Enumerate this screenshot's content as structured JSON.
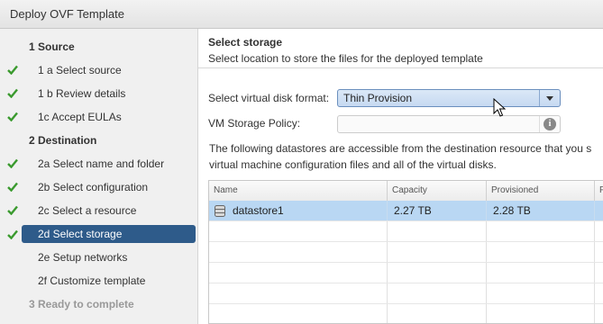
{
  "window": {
    "title": "Deploy OVF Template"
  },
  "sidebar": {
    "steps": [
      {
        "label": "1  Source",
        "type": "section",
        "done": false
      },
      {
        "label": "1 a  Select source",
        "type": "step",
        "done": true
      },
      {
        "label": "1 b  Review details",
        "type": "step",
        "done": true
      },
      {
        "label": "1c  Accept EULAs",
        "type": "step",
        "done": true
      },
      {
        "label": "2  Destination",
        "type": "section",
        "done": false
      },
      {
        "label": "2a  Select name and folder",
        "type": "step",
        "done": true
      },
      {
        "label": "2b  Select configuration",
        "type": "step",
        "done": true
      },
      {
        "label": "2c  Select a resource",
        "type": "step",
        "done": true
      },
      {
        "label": "2d  Select storage",
        "type": "step",
        "done": true,
        "active": true
      },
      {
        "label": "2e  Setup networks",
        "type": "step",
        "done": false
      },
      {
        "label": "2f  Customize template",
        "type": "step",
        "done": false
      },
      {
        "label": "3  Ready to complete",
        "type": "section",
        "done": false,
        "muted": true
      }
    ]
  },
  "main": {
    "heading": "Select storage",
    "subheading": "Select location to store the files for the deployed template",
    "disk_format": {
      "label": "Select virtual disk format:",
      "value": "Thin Provision"
    },
    "storage_policy": {
      "label": "VM Storage Policy:",
      "value": ""
    },
    "description_line1": "The following datastores are accessible from the destination resource that you s",
    "description_line2": "virtual machine configuration files and all of the virtual disks.",
    "table": {
      "columns": [
        "Name",
        "Capacity",
        "Provisioned",
        "F"
      ],
      "rows": [
        {
          "name": "datastore1",
          "capacity": "2.27 TB",
          "provisioned": "2.28 TB",
          "selected": true
        }
      ]
    }
  },
  "colors": {
    "accent": "#2e5b8a",
    "check": "#3a9a2e",
    "selection": "#b9d7f3"
  }
}
